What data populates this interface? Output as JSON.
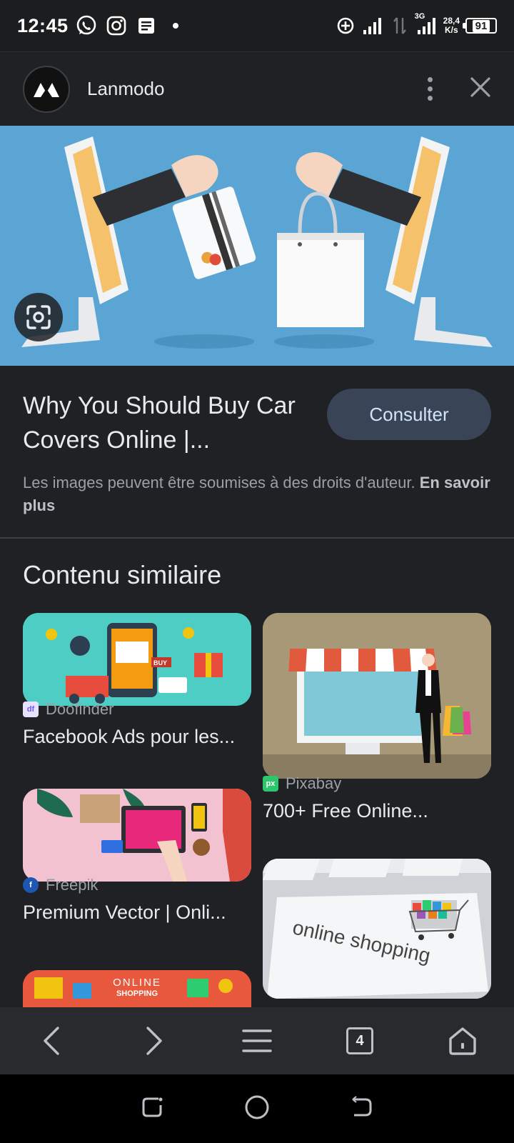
{
  "status_bar": {
    "time": "12:45",
    "network_type": "3G",
    "net_speed_value": "28,4",
    "net_speed_unit": "K/s",
    "battery": "91"
  },
  "header": {
    "site_name": "Lanmodo"
  },
  "info": {
    "title": "Why You Should Buy Car Covers Online |...",
    "consult_label": "Consulter",
    "copyright_text": "Les images peuvent être soumises à des droits d'auteur.",
    "learn_more": "En savoir plus"
  },
  "similar": {
    "heading": "Contenu similaire",
    "cards": [
      {
        "source": "Doofinder",
        "title": "Facebook Ads pour les..."
      },
      {
        "source": "Pixabay",
        "title": "700+ Free Online..."
      },
      {
        "source": "Freepik",
        "title": "Premium Vector | Onli..."
      },
      {
        "source": "",
        "title": ""
      },
      {
        "source": "",
        "title": ""
      }
    ],
    "image_texts": {
      "online_shopping": "online shopping",
      "online_shopping_poster_1": "ONLINE",
      "online_shopping_poster_2": "SHOPPING",
      "buy": "BUY"
    }
  },
  "toolbar": {
    "tab_count": "4"
  },
  "colors": {
    "background": "#202124",
    "accent_button": "#394457",
    "hero_sky": "#5aa5d3"
  }
}
